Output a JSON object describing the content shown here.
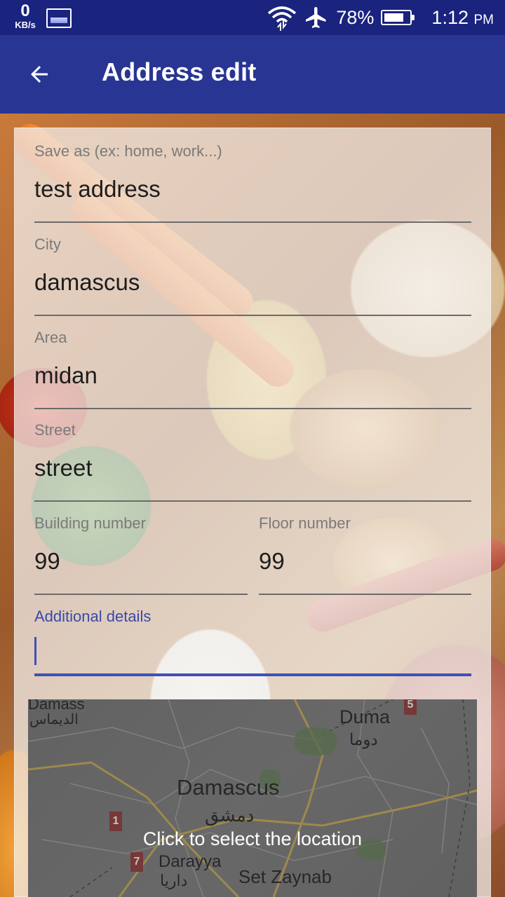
{
  "status_bar": {
    "net_speed_value": "0",
    "net_speed_unit": "KB/s",
    "battery_percent": "78%",
    "time": "1:12",
    "time_suffix": "PM"
  },
  "app_bar": {
    "title": "Address edit",
    "back_icon": "arrow-back-icon"
  },
  "form": {
    "save_as": {
      "label": "Save as (ex: home, work...)",
      "value": "test address"
    },
    "city": {
      "label": "City",
      "value": "damascus"
    },
    "area": {
      "label": "Area",
      "value": "midan"
    },
    "street": {
      "label": "Street",
      "value": "street"
    },
    "building_number": {
      "label": "Building number",
      "value": "99"
    },
    "floor_number": {
      "label": "Floor number",
      "value": "99"
    },
    "additional_details": {
      "label": "Additional details",
      "value": ""
    }
  },
  "map": {
    "cta": "Click to select the location",
    "places": {
      "top_left_en": "Damass",
      "top_left_ar": "الديماس",
      "duma_en": "Duma",
      "duma_ar": "دوما",
      "damascus_en": "Damascus",
      "damascus_ar": "دمشق",
      "darayya_en": "Darayya",
      "darayya_ar": "داريا",
      "set_zaynab_en": "Set Zaynab"
    },
    "route_shields": [
      "1",
      "7",
      "5"
    ]
  },
  "colors": {
    "status_bar": "#1a237e",
    "app_bar": "#283593",
    "accent": "#3f51b5"
  }
}
